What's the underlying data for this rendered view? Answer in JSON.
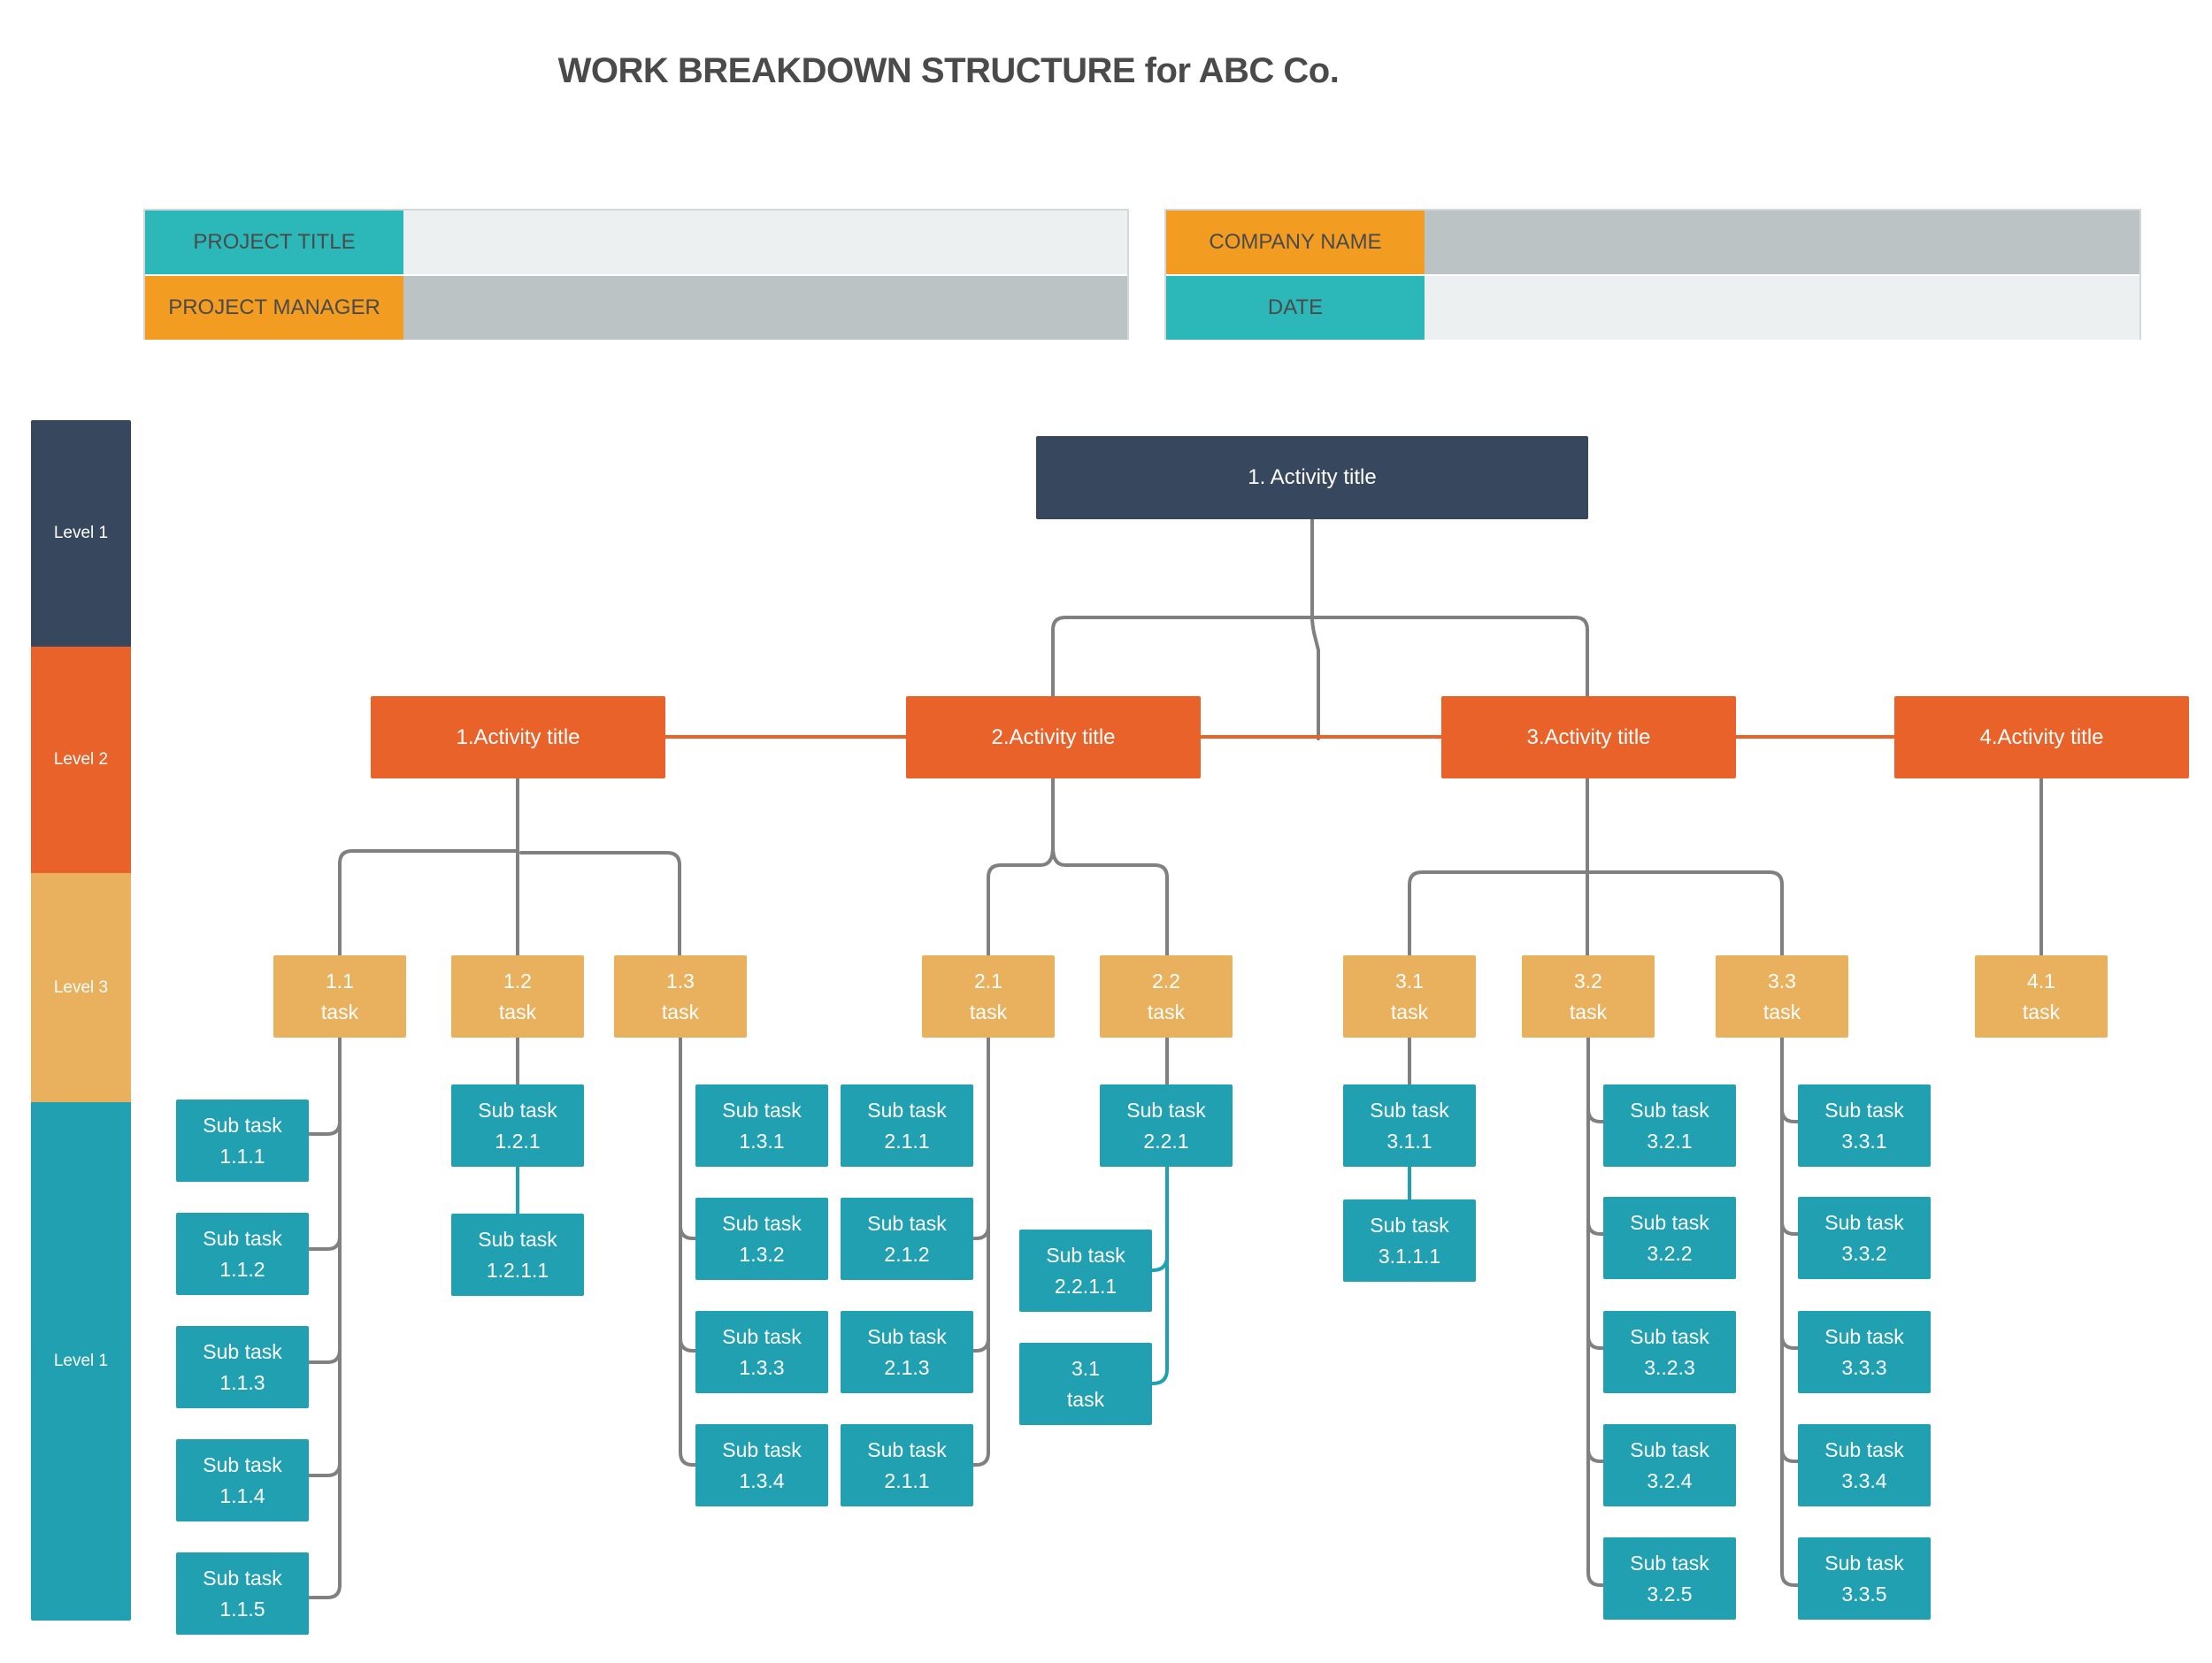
{
  "title": "WORK BREAKDOWN STRUCTURE for ABC Co.",
  "info_left": {
    "rows": [
      {
        "label": "PROJECT TITLE",
        "value": ""
      },
      {
        "label": "PROJECT MANAGER",
        "value": ""
      }
    ]
  },
  "info_right": {
    "rows": [
      {
        "label": "COMPANY NAME",
        "value": ""
      },
      {
        "label": "DATE",
        "value": ""
      }
    ]
  },
  "levels": [
    {
      "label": "Level 1",
      "color": "#36475e"
    },
    {
      "label": "Level 2",
      "color": "#e8622a"
    },
    {
      "label": "Level 3",
      "color": "#e9b15d"
    },
    {
      "label": "Level 1",
      "color": "#21a0b2"
    }
  ],
  "colors": {
    "root": "#36475e",
    "activity": "#e8622a",
    "task": "#e9b15d",
    "subtask": "#21a0b2",
    "connector": "#808080",
    "activity_connector": "#e8622a",
    "teal_label": "#2cb8b9",
    "orange_label": "#f29c22"
  },
  "root": {
    "label": "1. Activity title"
  },
  "activities": [
    {
      "label": "1.Activity title"
    },
    {
      "label": "2.Activity title"
    },
    {
      "label": "3.Activity title"
    },
    {
      "label": "4.Activity title"
    }
  ],
  "tasks": [
    {
      "id": "1.1",
      "line1": "1.1",
      "line2": "task"
    },
    {
      "id": "1.2",
      "line1": "1.2",
      "line2": "task"
    },
    {
      "id": "1.3",
      "line1": "1.3",
      "line2": "task"
    },
    {
      "id": "2.1",
      "line1": "2.1",
      "line2": "task"
    },
    {
      "id": "2.2",
      "line1": "2.2",
      "line2": "task"
    },
    {
      "id": "3.1",
      "line1": "3.1",
      "line2": "task"
    },
    {
      "id": "3.2",
      "line1": "3.2",
      "line2": "task"
    },
    {
      "id": "3.3",
      "line1": "3.3",
      "line2": "task"
    },
    {
      "id": "4.1",
      "line1": "4.1",
      "line2": "task"
    }
  ],
  "subtasks": [
    {
      "line1": "Sub task",
      "line2": "1.1.1"
    },
    {
      "line1": "Sub task",
      "line2": "1.1.2"
    },
    {
      "line1": "Sub task",
      "line2": "1.1.3"
    },
    {
      "line1": "Sub task",
      "line2": "1.1.4"
    },
    {
      "line1": "Sub task",
      "line2": "1.1.5"
    },
    {
      "line1": "Sub task",
      "line2": "1.2.1"
    },
    {
      "line1": "Sub task",
      "line2": "1.2.1.1"
    },
    {
      "line1": "Sub task",
      "line2": "1.3.1"
    },
    {
      "line1": "Sub task",
      "line2": "1.3.2"
    },
    {
      "line1": "Sub task",
      "line2": "1.3.3"
    },
    {
      "line1": "Sub task",
      "line2": "1.3.4"
    },
    {
      "line1": "Sub task",
      "line2": "2.1.1"
    },
    {
      "line1": "Sub task",
      "line2": "2.1.2"
    },
    {
      "line1": "Sub task",
      "line2": "2.1.3"
    },
    {
      "line1": "Sub task",
      "line2": "2.1.1"
    },
    {
      "line1": "Sub task",
      "line2": "2.2.1"
    },
    {
      "line1": "Sub task",
      "line2": "2.2.1.1"
    },
    {
      "line1": "3.1",
      "line2": "task"
    },
    {
      "line1": "Sub task",
      "line2": "3.1.1"
    },
    {
      "line1": "Sub task",
      "line2": "3.1.1.1"
    },
    {
      "line1": "Sub task",
      "line2": "3.2.1"
    },
    {
      "line1": "Sub task",
      "line2": "3.2.2"
    },
    {
      "line1": "Sub task",
      "line2": "3..2.3"
    },
    {
      "line1": "Sub task",
      "line2": "3.2.4"
    },
    {
      "line1": "Sub task",
      "line2": "3.2.5"
    },
    {
      "line1": "Sub task",
      "line2": "3.3.1"
    },
    {
      "line1": "Sub task",
      "line2": "3.3.2"
    },
    {
      "line1": "Sub task",
      "line2": "3.3.3"
    },
    {
      "line1": "Sub task",
      "line2": "3.3.4"
    },
    {
      "line1": "Sub task",
      "line2": "3.3.5"
    }
  ]
}
